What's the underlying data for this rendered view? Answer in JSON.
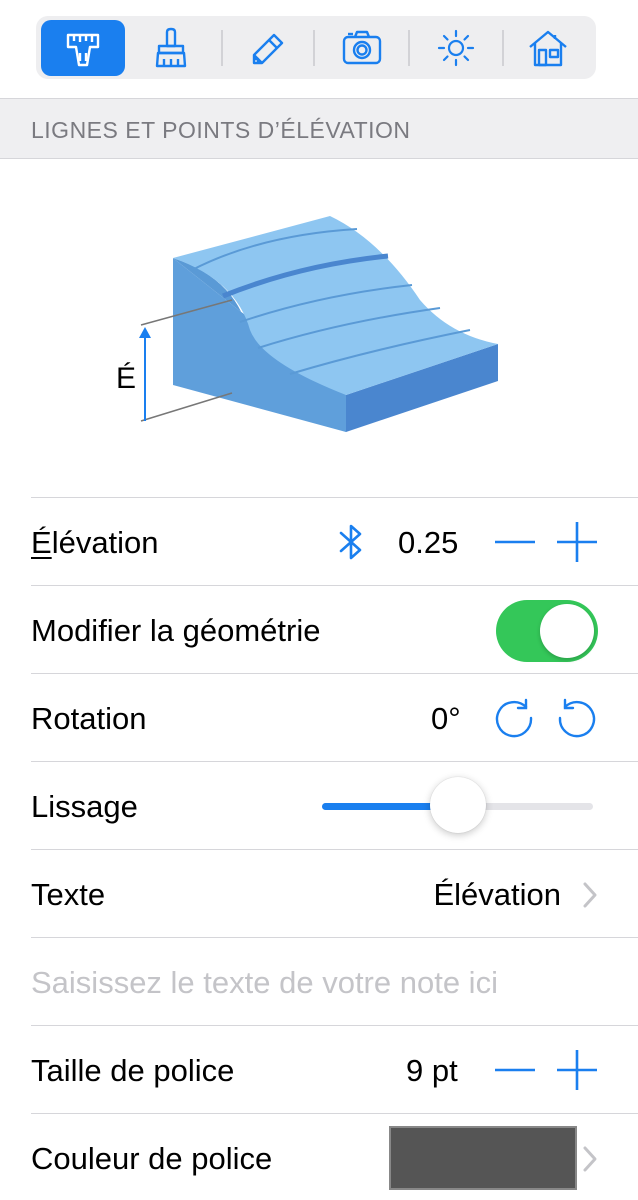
{
  "toolbar": {
    "tabs": [
      {
        "name": "measure",
        "icon": "caliper-icon",
        "active": true
      },
      {
        "name": "style",
        "icon": "brush-icon",
        "active": false
      },
      {
        "name": "draw",
        "icon": "pencil-icon",
        "active": false
      },
      {
        "name": "camera",
        "icon": "camera-icon",
        "active": false
      },
      {
        "name": "light",
        "icon": "sun-icon",
        "active": false
      },
      {
        "name": "building",
        "icon": "house-icon",
        "active": false
      }
    ],
    "accent": "#1a7fef"
  },
  "section": {
    "title": "LIGNES ET POINTS D’ÉLÉVATION"
  },
  "illustration": {
    "elevation_letter": "É"
  },
  "rows": {
    "elevation": {
      "label_first": "É",
      "label_rest": "lévation",
      "value": "0.25",
      "icon": "bluetooth-icon"
    },
    "modify_geometry": {
      "label": "Modifier la géométrie",
      "on": true,
      "on_color": "#34c759"
    },
    "rotation": {
      "label": "Rotation",
      "value": "0°"
    },
    "smoothing": {
      "label": "Lissage",
      "level": 0.5
    },
    "text": {
      "label": "Texte",
      "value": "Élévation"
    },
    "note": {
      "placeholder": "Saisissez le texte de votre note ici"
    },
    "font_size": {
      "label": "Taille de police",
      "value": "9 pt"
    },
    "font_color": {
      "label": "Couleur de police",
      "color": "#555555"
    }
  }
}
